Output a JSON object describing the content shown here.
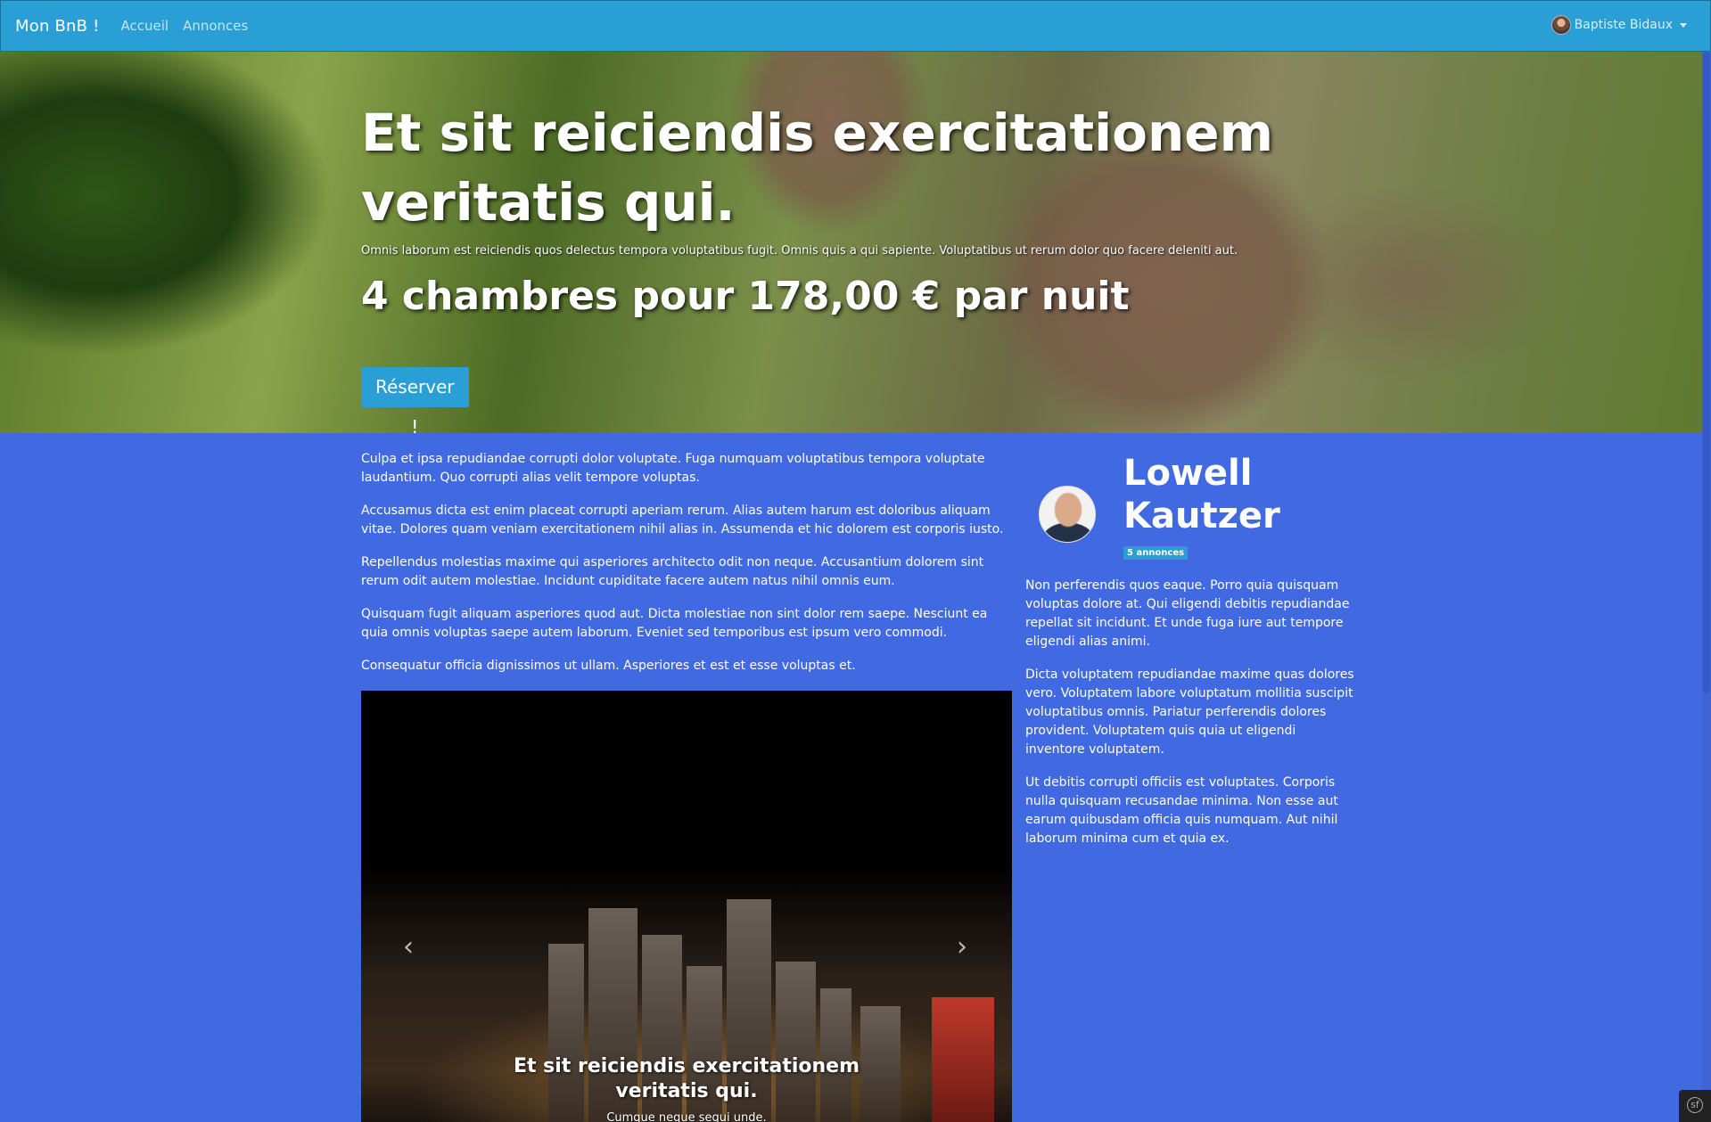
{
  "navbar": {
    "brand": "Mon BnB !",
    "links": [
      "Accueil",
      "Annonces"
    ],
    "user": "Baptiste Bidaux"
  },
  "hero": {
    "title": "Et sit reiciendis exercitationem veritatis qui.",
    "subtitle": "Omnis laborum est reiciendis quos delectus tempora voluptatibus fugit. Omnis quis a qui sapiente. Voluptatibus ut rerum dolor quo facere deleniti aut.",
    "rooms": "4 chambres",
    "pour": "pour",
    "price": "178,00 €",
    "per_night": "par nuit",
    "reserve_label": "Réserver !"
  },
  "content": {
    "paragraphs": [
      "Culpa et ipsa repudiandae corrupti dolor voluptate. Fuga numquam voluptatibus tempora voluptate laudantium. Quo corrupti alias velit tempore voluptas.",
      "Accusamus dicta est enim placeat corrupti aperiam rerum. Alias autem harum est doloribus aliquam vitae. Dolores quam veniam exercitationem nihil alias in. Assumenda et hic dolorem est corporis iusto.",
      "Repellendus molestias maxime qui asperiores architecto odit non neque. Accusantium dolorem sint rerum odit autem molestiae. Incidunt cupiditate facere autem natus nihil omnis eum.",
      "Quisquam fugit aliquam asperiores quod aut. Dicta molestiae non sint dolor rem saepe. Nesciunt ea quia omnis voluptas saepe autem laborum. Eveniet sed temporibus est ipsum vero commodi.",
      "Consequatur officia dignissimos ut ullam. Asperiores et est et esse voluptas et."
    ]
  },
  "carousel": {
    "caption_title": "Et sit reiciendis exercitationem veritatis qui.",
    "caption_text": "Cumque neque sequi unde.",
    "prev_icon": "‹",
    "next_icon": "›"
  },
  "owner": {
    "name": "Lowell Kautzer",
    "badge": "5 annonces",
    "bio": [
      "Non perferendis quos eaque. Porro quia quisquam voluptas dolore at. Qui eligendi debitis repudiandae repellat sit incidunt. Et unde fuga iure aut tempore eligendi alias animi.",
      "Dicta voluptatem repudiandae maxime quas dolores vero. Voluptatem labore voluptatum mollitia suscipit voluptatibus omnis. Pariatur perferendis dolores provident. Voluptatem quis quia ut eligendi inventore voluptatem.",
      "Ut debitis corrupti officiis est voluptates. Corporis nulla quisquam recusandae minima. Non esse aut earum quibusdam officia quis numquam. Aut nihil laborum minima cum et quia ex."
    ]
  },
  "colors": {
    "page_background": "#4169e1",
    "navbar": "#2a9fd6",
    "accent": "#2a9fd6"
  }
}
